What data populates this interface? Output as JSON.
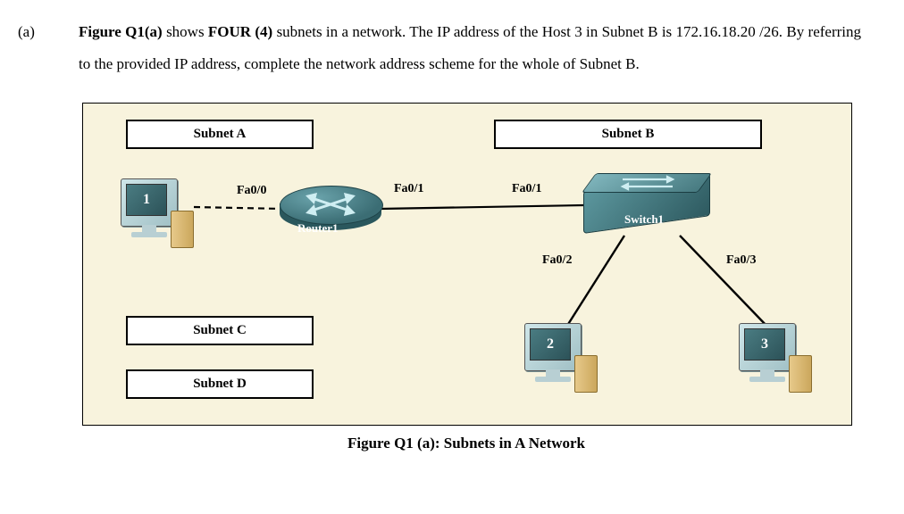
{
  "question": {
    "number": "(a)",
    "text_parts": {
      "p1": "Figure Q1(a)",
      "p2": " shows ",
      "p3": "FOUR (4)",
      "p4": " subnets in a network. The IP address of the Host 3 in Subnet B is 172.16.18.20 /26. By referring to the provided IP address, complete the network address scheme for the whole of Subnet B."
    }
  },
  "labels": {
    "subnetA": "Subnet A",
    "subnetB": "Subnet B",
    "subnetC": "Subnet C",
    "subnetD": "Subnet D",
    "router": "Router1",
    "switch": "Switch1",
    "host1": "1",
    "host2": "2",
    "host3": "3",
    "if_fa00": "Fa0/0",
    "if_fa01_r": "Fa0/1",
    "if_fa01_s": "Fa0/1",
    "if_fa02": "Fa0/2",
    "if_fa03": "Fa0/3"
  },
  "caption": "Figure Q1 (a): Subnets in A Network"
}
